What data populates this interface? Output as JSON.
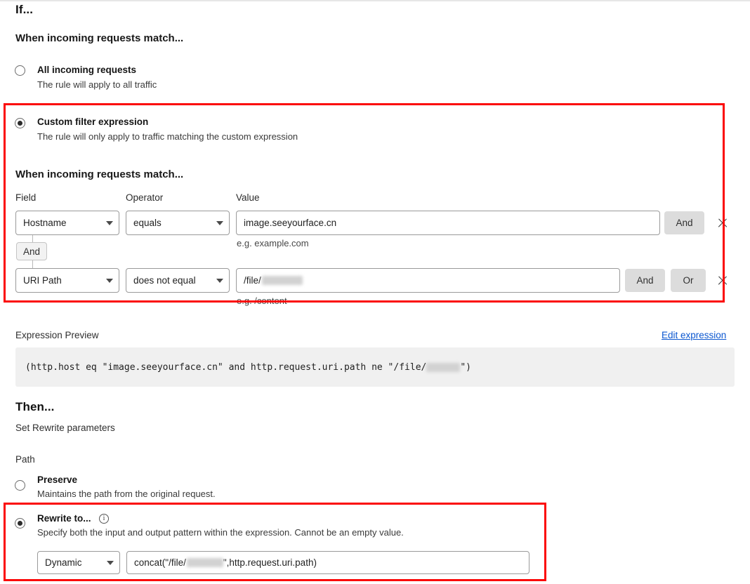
{
  "if_section": {
    "title": "If...",
    "heading": "When incoming requests match...",
    "options": [
      {
        "title": "All incoming requests",
        "desc": "The rule will apply to all traffic",
        "selected": false
      },
      {
        "title": "Custom filter expression",
        "desc": "The rule will only apply to traffic matching the custom expression",
        "selected": true
      }
    ],
    "builder_heading": "When incoming requests match...",
    "columns": {
      "field": "Field",
      "operator": "Operator",
      "value": "Value"
    },
    "rows": [
      {
        "field": "Hostname",
        "operator": "equals",
        "value": "image.seeyourface.cn",
        "value_redacted": false,
        "hint": "e.g. example.com",
        "and_label": "And",
        "or_label": null
      },
      {
        "field": "URI Path",
        "operator": "does not equal",
        "value": "/file/",
        "value_redacted": true,
        "hint": "e.g. /content",
        "and_label": "And",
        "or_label": "Or"
      }
    ],
    "row_connector_label": "And"
  },
  "expression": {
    "label": "Expression Preview",
    "edit_link": "Edit expression",
    "preview_prefix": "(http.host eq \"image.seeyourface.cn\" and http.request.uri.path ne \"/file/",
    "preview_suffix": "\")"
  },
  "then_section": {
    "title": "Then...",
    "subtitle": "Set Rewrite parameters",
    "path_label": "Path",
    "options": [
      {
        "title": "Preserve",
        "desc": "Maintains the path from the original request.",
        "selected": false
      },
      {
        "title": "Rewrite to...",
        "desc": "Specify both the input and output pattern within the expression. Cannot be an empty value.",
        "selected": true
      }
    ],
    "rewrite_mode": "Dynamic",
    "rewrite_value_prefix": "concat(\"/file/",
    "rewrite_value_suffix": "\",http.request.uri.path)"
  },
  "icons": {
    "close": "close-icon",
    "info": "info-icon",
    "caret": "chevron-down-icon"
  },
  "colors": {
    "annotation": "#fb0707",
    "link": "#0b57d0",
    "button_gray": "#dcdcdc",
    "expr_bg": "#f0f0f0"
  }
}
